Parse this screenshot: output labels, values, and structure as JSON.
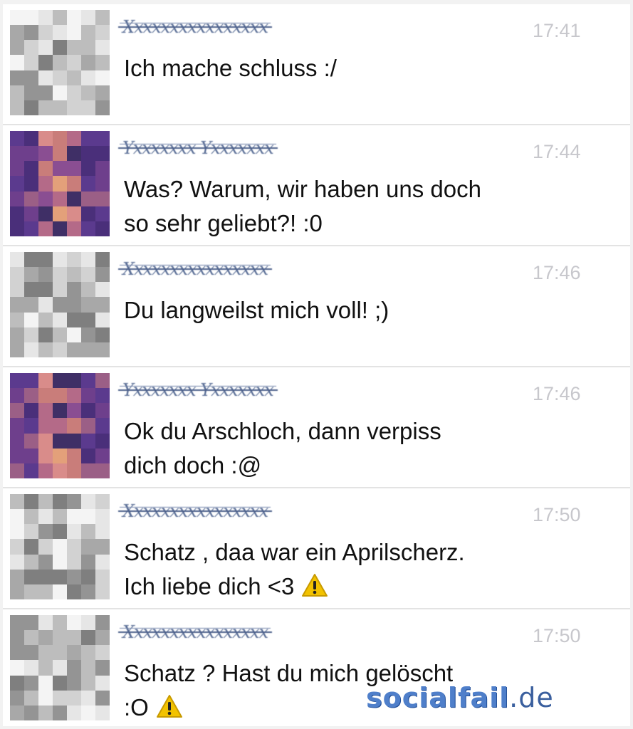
{
  "colors": {
    "time_gray": "#c7c7cc",
    "name_blue": "#5a6e96",
    "divider": "#e3e3e3",
    "watermark_blue": "#4f7fca",
    "warning_yellow": "#f2c200"
  },
  "messages": [
    {
      "sender": "Xxxxxxxxxxxxxxxx",
      "time": "17:41",
      "lines": [
        "Ich mache schluss :/"
      ],
      "avatar": "gray",
      "warning": false
    },
    {
      "sender": "Yxxxxxxx Yxxxxxxx",
      "time": "17:44",
      "lines": [
        "Was? Warum, wir haben uns doch",
        "so sehr geliebt?!  :0"
      ],
      "avatar": "purple",
      "warning": false
    },
    {
      "sender": "Xxxxxxxxxxxxxxxx",
      "time": "17:46",
      "lines": [
        "Du langweilst mich voll! ;)"
      ],
      "avatar": "gray",
      "warning": false
    },
    {
      "sender": "Yxxxxxxx Yxxxxxxx",
      "time": "17:46",
      "lines": [
        "Ok du Arschloch, dann verpiss",
        "dich doch :@"
      ],
      "avatar": "purple",
      "warning": false
    },
    {
      "sender": "Xxxxxxxxxxxxxxxx",
      "time": "17:50",
      "lines": [
        "Schatz , daa war ein Aprilscherz.",
        "Ich liebe dich <3"
      ],
      "avatar": "gray",
      "warning": true
    },
    {
      "sender": "Xxxxxxxxxxxxxxxx",
      "time": "17:50",
      "lines": [
        "Schatz ? Hast du mich gelöscht",
        ":O"
      ],
      "avatar": "gray",
      "warning": true
    }
  ],
  "watermark": {
    "name": "socialfail",
    "tld": ".de"
  }
}
